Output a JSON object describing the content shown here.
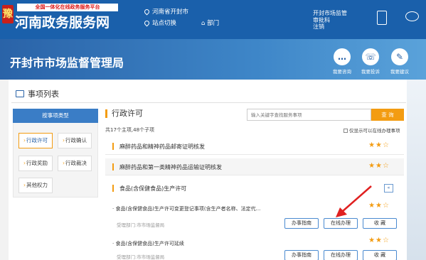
{
  "header": {
    "platform_tag": "全国一体化在线政务服务平台",
    "site_name": "河南政务服务网",
    "logo_glyph": "豫",
    "location": "河南省开封市",
    "site_switch": "站点切换",
    "department": "部门",
    "user_links": [
      "开封市场监管",
      "审批科",
      "注销"
    ]
  },
  "banner": {
    "title": "开封市市场监督管理局",
    "services": [
      {
        "label": "我要咨询",
        "icon": "chat-icon",
        "glyph": "…"
      },
      {
        "label": "我要投诉",
        "icon": "phone-icon",
        "glyph": "☏"
      },
      {
        "label": "我要建议",
        "icon": "bulb-icon",
        "glyph": "✎"
      }
    ]
  },
  "section": {
    "title": "事项列表"
  },
  "categories": {
    "header": "按事项类型",
    "items": [
      {
        "label": "行政许可",
        "active": true
      },
      {
        "label": "行政确认",
        "active": false
      },
      {
        "label": "行政奖励",
        "active": false
      },
      {
        "label": "行政裁决",
        "active": false
      },
      {
        "label": "其他权力",
        "active": false
      }
    ],
    "chevron": "›"
  },
  "main": {
    "title": "行政许可",
    "search_placeholder": "输入关键字查找服务事项",
    "search_button": "查 询",
    "count": "共17个主项,48个子项",
    "online_only": "仅显示可以在线办理事项"
  },
  "items": [
    {
      "title": "麻醉药品和精神药品邮寄证明核发",
      "stars": "★★☆",
      "grey": false
    },
    {
      "title": "麻醉药品和第一类精神药品运输证明核发",
      "stars": "★★☆",
      "grey": true
    },
    {
      "title": "食品(含保健食品)生产许可",
      "expand": "«",
      "grey": false
    }
  ],
  "subitems": [
    {
      "title": "· 食品(含保健食品)生产许可变更登记事项(含生产者名称、法定代...",
      "dept": "受理部门:市市场监督局",
      "stars": "★★☆"
    },
    {
      "title": "· 食品(含保健食品)生产许可延续",
      "dept": "受理部门:市市场监督局",
      "stars": "★★☆"
    }
  ],
  "buttons": {
    "guide": "办事指南",
    "online": "在线办理",
    "favorite": "收 藏"
  },
  "colors": {
    "header_blue": "#1a60ab",
    "accent_orange": "#f39c12",
    "arrow_red": "#e02020"
  }
}
